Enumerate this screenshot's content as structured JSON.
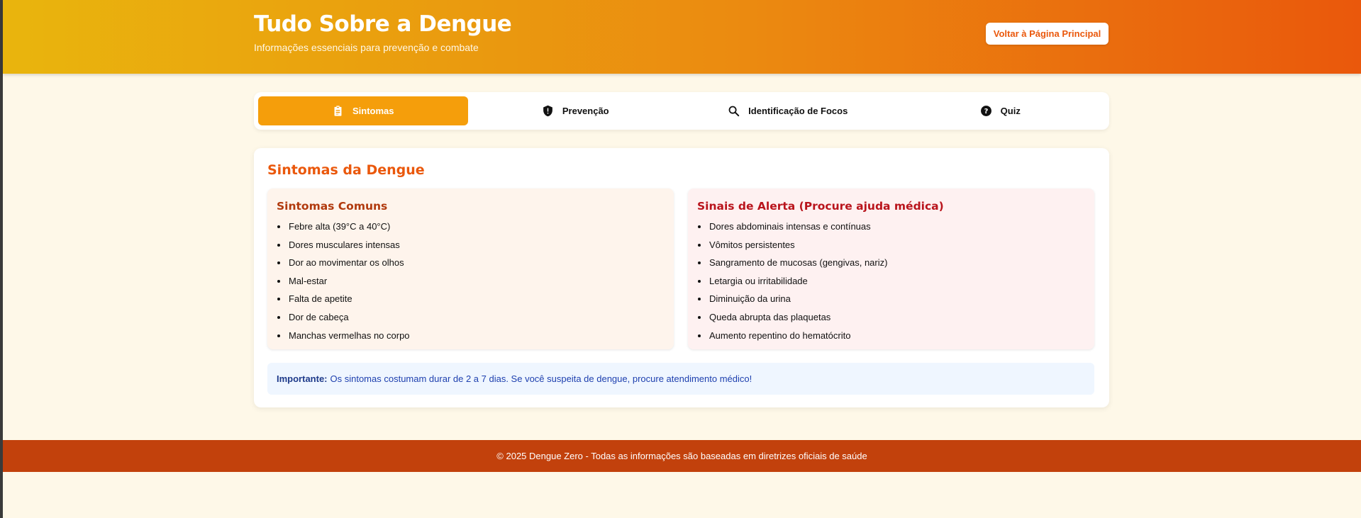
{
  "header": {
    "title": "Tudo Sobre a Dengue",
    "subtitle": "Informações essenciais para prevenção e combate",
    "back_button": "Voltar à Página Principal"
  },
  "tabs": [
    {
      "label": "Sintomas",
      "icon": "clipboard-icon",
      "active": true
    },
    {
      "label": "Prevenção",
      "icon": "shield-icon",
      "active": false
    },
    {
      "label": "Identificação de Focos",
      "icon": "search-icon",
      "active": false
    },
    {
      "label": "Quiz",
      "icon": "question-circle-icon",
      "active": false
    }
  ],
  "section": {
    "title": "Sintomas da Dengue",
    "common": {
      "title": "Sintomas Comuns",
      "items": [
        "Febre alta (39°C a 40°C)",
        "Dores musculares intensas",
        "Dor ao movimentar os olhos",
        "Mal-estar",
        "Falta de apetite",
        "Dor de cabeça",
        "Manchas vermelhas no corpo"
      ]
    },
    "alert": {
      "title": "Sinais de Alerta (Procure ajuda médica)",
      "items": [
        "Dores abdominais intensas e contínuas",
        "Vômitos persistentes",
        "Sangramento de mucosas (gengivas, nariz)",
        "Letargia ou irritabilidade",
        "Diminuição da urina",
        "Queda abrupta das plaquetas",
        "Aumento repentino do hematócrito"
      ]
    },
    "important": {
      "label": "Importante:",
      "text": "Os sintomas costumam durar de 2 a 7 dias. Se você suspeita de dengue, procure atendimento médico!"
    }
  },
  "footer": {
    "text": "© 2025 Dengue Zero - Todas as informações são baseadas em diretrizes oficiais de saúde"
  },
  "colors": {
    "accent": "#f59e0b",
    "header_start": "#e9b50d",
    "header_end": "#ea580c",
    "title_orange": "#ea580c",
    "footer": "#c2410c",
    "alert_red": "#b9141c",
    "info_blue": "#1e40af"
  }
}
